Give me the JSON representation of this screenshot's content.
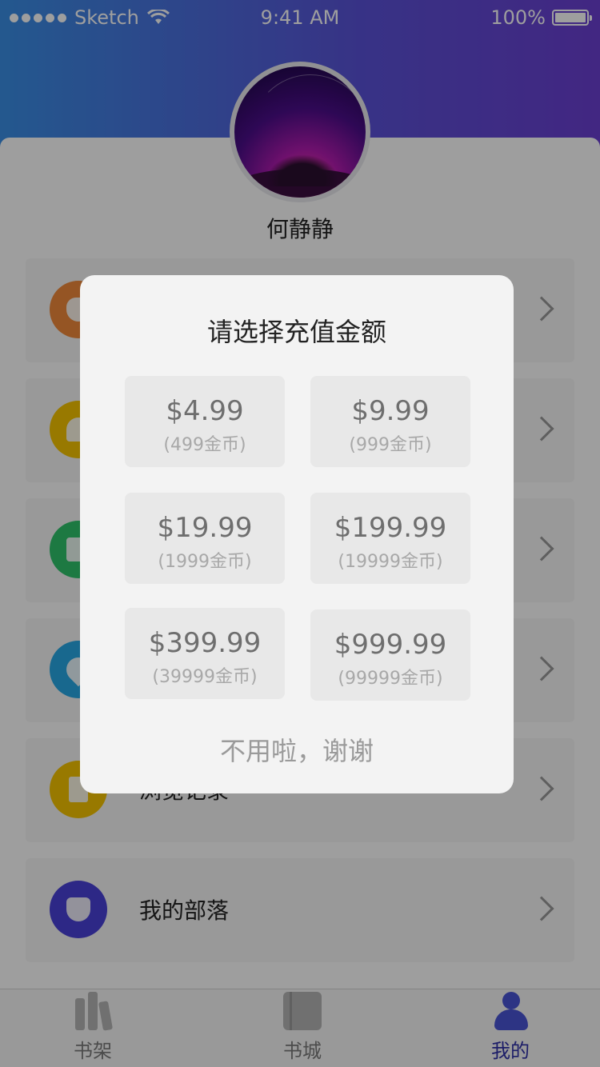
{
  "status_bar": {
    "carrier": "Sketch",
    "time": "9:41 AM",
    "battery": "100%"
  },
  "profile": {
    "name": "何静静"
  },
  "menu": {
    "items": [
      {
        "label": "",
        "icon": "money-bag-icon",
        "color": "#f08a3a"
      },
      {
        "label": "",
        "icon": "bell-icon",
        "color": "#f5c400"
      },
      {
        "label": "",
        "icon": "chat-bubble-icon",
        "color": "#2fc46b"
      },
      {
        "label": "",
        "icon": "heart-icon",
        "color": "#27a9e6"
      },
      {
        "label": "浏览记录",
        "icon": "notebook-icon",
        "color": "#f5c400"
      },
      {
        "label": "我的部落",
        "icon": "shield-icon",
        "color": "#4a42d8"
      }
    ]
  },
  "dialog": {
    "title": "请选择充值金额",
    "options": [
      {
        "price": "$4.99",
        "coins": "(499金币)"
      },
      {
        "price": "$9.99",
        "coins": "(999金币)"
      },
      {
        "price": "$19.99",
        "coins": "(1999金币)"
      },
      {
        "price": "$199.99",
        "coins": "(19999金币)"
      },
      {
        "price": "$399.99",
        "coins": "(39999金币)"
      },
      {
        "price": "$999.99",
        "coins": "(99999金币)"
      }
    ],
    "dismiss_label": "不用啦，谢谢"
  },
  "tab_bar": {
    "tabs": [
      {
        "label": "书架",
        "icon": "bookshelf-icon"
      },
      {
        "label": "书城",
        "icon": "book-icon"
      },
      {
        "label": "我的",
        "icon": "user-icon",
        "active": true
      }
    ]
  },
  "colors": {
    "header_start": "#3a8fe6",
    "header_end": "#6b3fd2",
    "active_tab": "#2e2fa8"
  }
}
